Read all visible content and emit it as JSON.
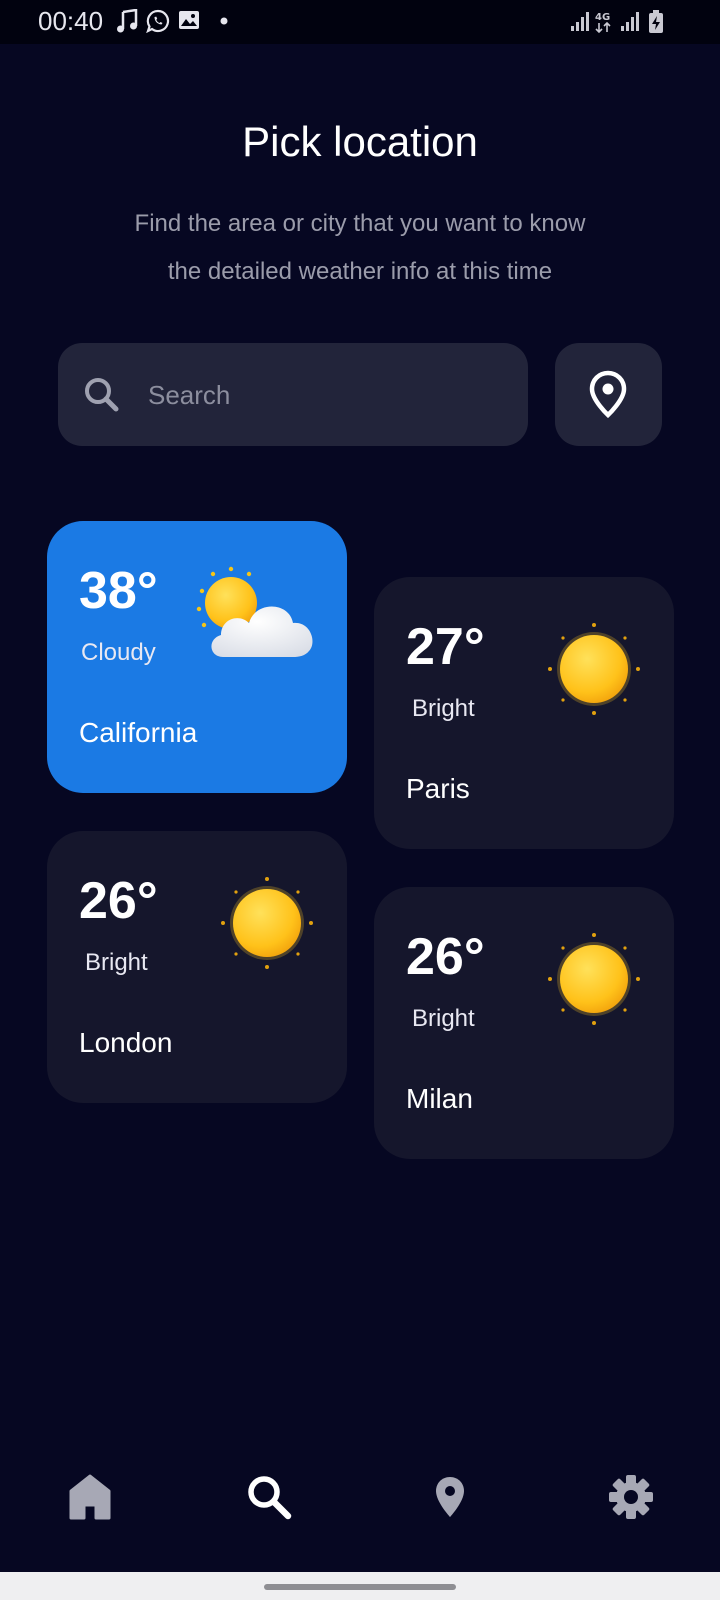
{
  "status_bar": {
    "time": "00:40",
    "left_icons": [
      "music-note-icon",
      "whatsapp-icon",
      "image-icon",
      "dot-icon"
    ],
    "right_icons": [
      "signal-icon",
      "4g-data-icon",
      "signal-icon",
      "battery-charging-icon"
    ],
    "network_label": "4G"
  },
  "header": {
    "title": "Pick location",
    "subtitle_line1": "Find the area or city that you want to know",
    "subtitle_line2": "the detailed weather info at this time"
  },
  "search": {
    "placeholder": "Search",
    "value": "",
    "icon": "search-icon"
  },
  "location_button": {
    "icon": "map-pin-icon"
  },
  "cards": [
    {
      "temp": "38°",
      "condition": "Cloudy",
      "city": "California",
      "icon": "sun-cloud-icon",
      "selected": true
    },
    {
      "temp": "27°",
      "condition": "Bright",
      "city": "Paris",
      "icon": "sun-icon",
      "selected": false
    },
    {
      "temp": "26°",
      "condition": "Bright",
      "city": "London",
      "icon": "sun-icon",
      "selected": false
    },
    {
      "temp": "26°",
      "condition": "Bright",
      "city": "Milan",
      "icon": "sun-icon",
      "selected": false
    }
  ],
  "bottom_nav": {
    "items": [
      {
        "icon": "home-icon",
        "active": false
      },
      {
        "icon": "search-icon",
        "active": true
      },
      {
        "icon": "location-icon",
        "active": false
      },
      {
        "icon": "gear-icon",
        "active": false
      }
    ]
  },
  "colors": {
    "background": "#060722",
    "card": "#15162c",
    "card_selected": "#1b7ae4",
    "input": "#22243a",
    "sun": "#ffc81f",
    "nav_inactive": "#a7a8b5",
    "nav_active": "#ffffff"
  }
}
